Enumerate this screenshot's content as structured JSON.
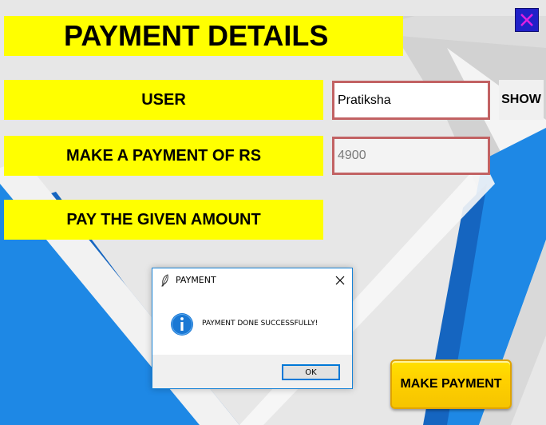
{
  "title": "PAYMENT DETAILS",
  "fields": {
    "user_label": "USER",
    "user_value": "Pratiksha",
    "show_label": "SHOW",
    "amount_label": "MAKE A PAYMENT OF RS",
    "amount_value": "4900",
    "pay_label": "PAY THE GIVEN AMOUNT"
  },
  "make_payment_label": "MAKE PAYMENT",
  "dialog": {
    "title": "PAYMENT",
    "message": "PAYMENT DONE SUCCESSFULLY!",
    "ok_label": "OK"
  },
  "colors": {
    "label_bg": "#ffff00",
    "entry_border": "#c26263",
    "accent_blue": "#1e88e5",
    "close_button": "#2020c8",
    "close_x": "#e020e0"
  },
  "icons": {
    "window_close": "close-icon",
    "dialog_app": "feather-icon",
    "dialog_close": "close-icon",
    "dialog_info": "info-icon"
  }
}
